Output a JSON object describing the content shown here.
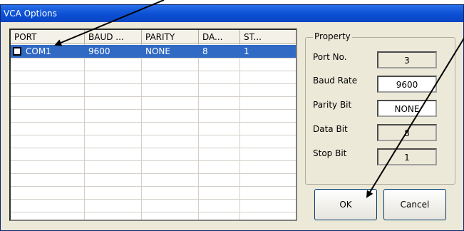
{
  "window": {
    "title": "VCA Options"
  },
  "list": {
    "columns": [
      "PORT",
      "BAUD ...",
      "PARITY",
      "DA...",
      "ST..."
    ],
    "rows": [
      {
        "port": "COM1",
        "baud": "9600",
        "parity": "NONE",
        "data": "8",
        "stop": "1",
        "checked": false
      }
    ]
  },
  "property": {
    "title": "Property",
    "port_no": {
      "label": "Port No.",
      "value": "3"
    },
    "baud_rate": {
      "label": "Baud Rate",
      "value": "9600"
    },
    "parity_bit": {
      "label": "Parity Bit",
      "value": "NONE"
    },
    "data_bit": {
      "label": "Data Bit",
      "value": "8"
    },
    "stop_bit": {
      "label": "Stop Bit",
      "value": "1"
    }
  },
  "buttons": {
    "ok": "OK",
    "cancel": "Cancel"
  },
  "colors": {
    "titlebar": "#0b4fd4",
    "selection": "#316ac5",
    "face": "#ece9d8"
  }
}
